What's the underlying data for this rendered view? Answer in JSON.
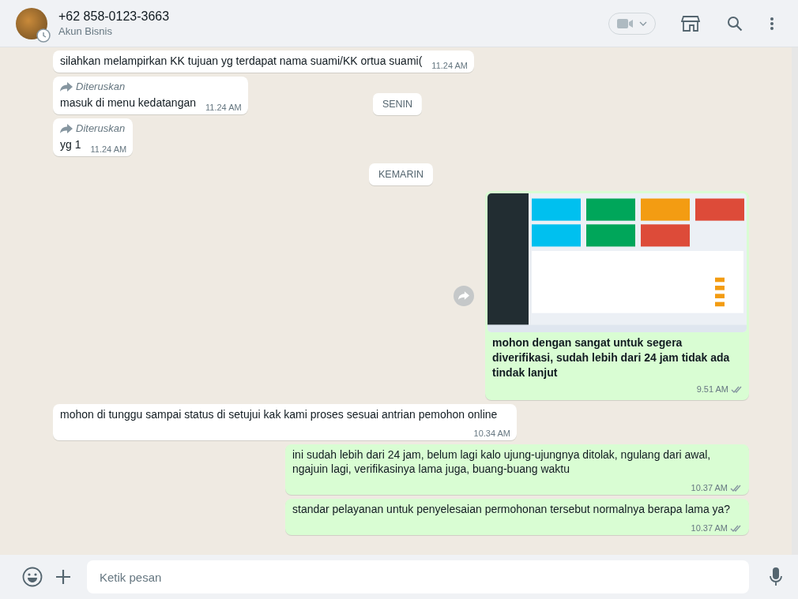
{
  "header": {
    "name": "+62 858-0123-3663",
    "subtitle": "Akun Bisnis"
  },
  "sticky_date": "SENIN",
  "messages": [
    {
      "kind": "in",
      "forwarded": false,
      "text": "silahkan melampirkan KK tujuan yg terdapat nama suami/KK ortua suami(",
      "time": "11.24 AM"
    },
    {
      "kind": "in",
      "forwarded": true,
      "forwarded_label": "Diteruskan",
      "text": "masuk di menu kedatangan",
      "time": "11.24 AM"
    },
    {
      "kind": "in",
      "forwarded": true,
      "forwarded_label": "Diteruskan",
      "text": "yg 1",
      "time": "11.24 AM"
    },
    {
      "kind": "date",
      "text": "KEMARIN"
    },
    {
      "kind": "out-image",
      "caption": "mohon dengan sangat untuk segera diverifikasi, sudah lebih dari 24 jam tidak ada tindak lanjut",
      "time": "9.51 AM",
      "read": false
    },
    {
      "kind": "in",
      "forwarded": false,
      "text": "mohon di tunggu sampai status di setujui kak kami proses sesuai antrian pemohon online",
      "time": "10.34 AM"
    },
    {
      "kind": "out",
      "text": "ini sudah lebih dari 24 jam, belum lagi kalo ujung-ujungnya ditolak, ngulang dari awal, ngajuin lagi, verifikasinya lama juga, buang-buang waktu",
      "time": "10.37 AM",
      "read": false
    },
    {
      "kind": "out",
      "text": "standar pelayanan untuk penyelesaian permohonan tersebut normalnya berapa lama ya?",
      "time": "10.37 AM",
      "read": false
    }
  ],
  "composer": {
    "placeholder": "Ketik pesan"
  }
}
